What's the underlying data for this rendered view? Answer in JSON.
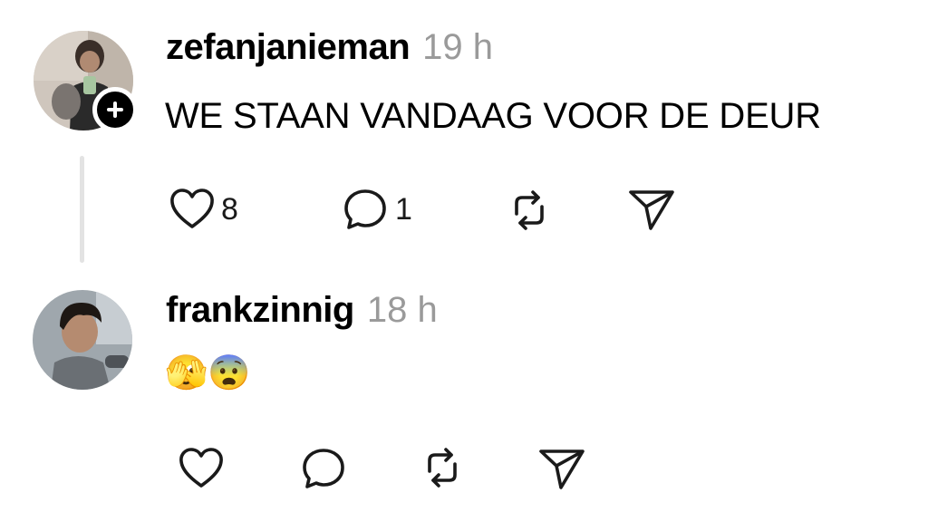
{
  "posts": [
    {
      "username": "zefanjanieman",
      "time": "19 h",
      "text": "WE STAAN VANDAAG VOOR DE DEUR",
      "follow_icon": "plus-icon",
      "actions": {
        "like_count": "8",
        "reply_count": "1",
        "like_icon": "heart-icon",
        "reply_icon": "comment-icon",
        "repost_icon": "repost-icon",
        "share_icon": "send-icon"
      }
    },
    {
      "username": "frankzinnig",
      "time": "18 h",
      "text": "🫣😨",
      "actions": {
        "like_icon": "heart-icon",
        "reply_icon": "comment-icon",
        "repost_icon": "repost-icon",
        "share_icon": "send-icon"
      }
    }
  ],
  "colors": {
    "time": "#9a9a9a",
    "thread_line": "#e3e3e3",
    "icon": "#1a1a1a"
  }
}
